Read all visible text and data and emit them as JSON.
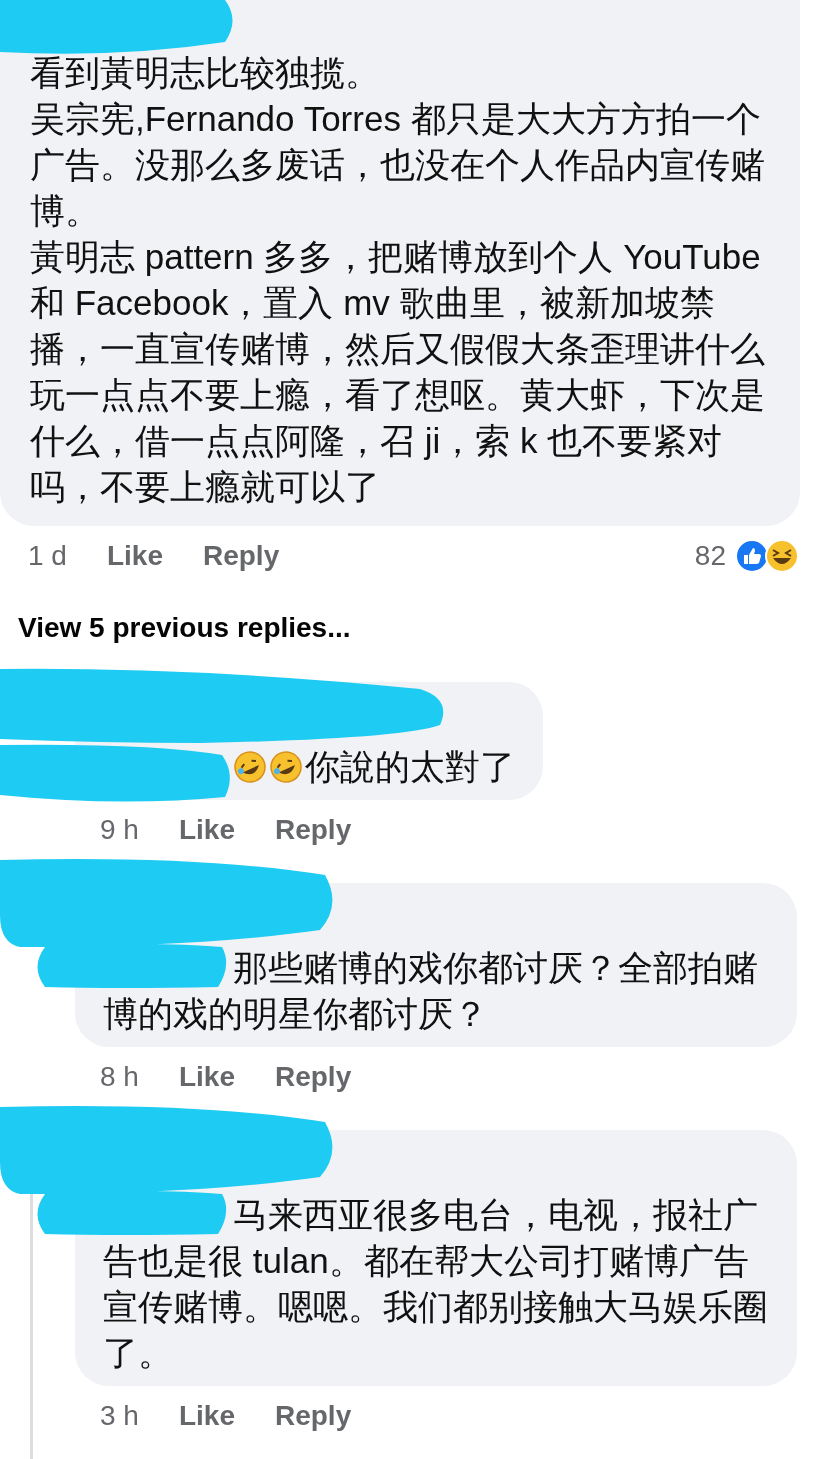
{
  "comment": {
    "paragraphs": [
      "看到黃明志比较独揽。",
      "吴宗宪,Fernando Torres 都只是大大方方拍一个广告。没那么多废话，也没在个人作品内宣传赌博。",
      "黃明志 pattern 多多，把赌博放到个人 YouTube 和 Facebook，置入 mv 歌曲里，被新加坡禁播，一直宣传赌博，然后又假假大条歪理讲什么玩一点点不要上瘾，看了想呕。黄大虾，下次是什么，借一点点阿隆，召 ji，索 k 也不要紧对吗，不要上瘾就可以了"
    ],
    "time": "1 d",
    "like": "Like",
    "reply": "Reply",
    "reaction_count": "82"
  },
  "view_previous": "View 5 previous replies...",
  "replies": [
    {
      "kind": "emoji",
      "text": "你說的太對了",
      "time": "9 h",
      "like": "Like",
      "reply": "Reply",
      "thread_line": false
    },
    {
      "kind": "text",
      "text": "那些赌博的戏你都讨厌？全部拍赌博的戏的明星你都讨厌？",
      "time": "8 h",
      "like": "Like",
      "reply": "Reply",
      "thread_line": false
    },
    {
      "kind": "text",
      "text": "马来西亚很多电台，电视，报社广告也是很 tulan。都在帮大公司打赌博广告宣传赌博。嗯嗯。我们都别接触大马娱乐圈了。",
      "time": "3 h",
      "like": "Like",
      "reply": "Reply",
      "thread_line": true
    }
  ]
}
